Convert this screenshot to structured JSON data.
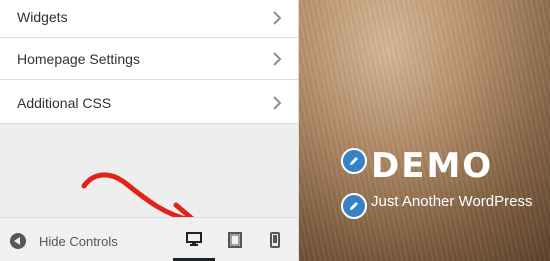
{
  "sidebar": {
    "items": [
      {
        "label": "Widgets"
      },
      {
        "label": "Homepage Settings"
      },
      {
        "label": "Additional CSS"
      }
    ]
  },
  "footer": {
    "hide_controls_label": "Hide Controls",
    "devices": [
      {
        "name": "desktop",
        "active": true
      },
      {
        "name": "tablet",
        "active": false
      },
      {
        "name": "mobile",
        "active": false
      }
    ]
  },
  "preview": {
    "site_title": "DEMO",
    "tagline": "Just Another WordPress"
  },
  "colors": {
    "accent": "#3582c4",
    "annotation": "#e2231a"
  },
  "icons": [
    "chevron-right-icon",
    "arrow-left-circle-icon",
    "desktop-icon",
    "tablet-icon",
    "mobile-icon",
    "pencil-icon"
  ]
}
